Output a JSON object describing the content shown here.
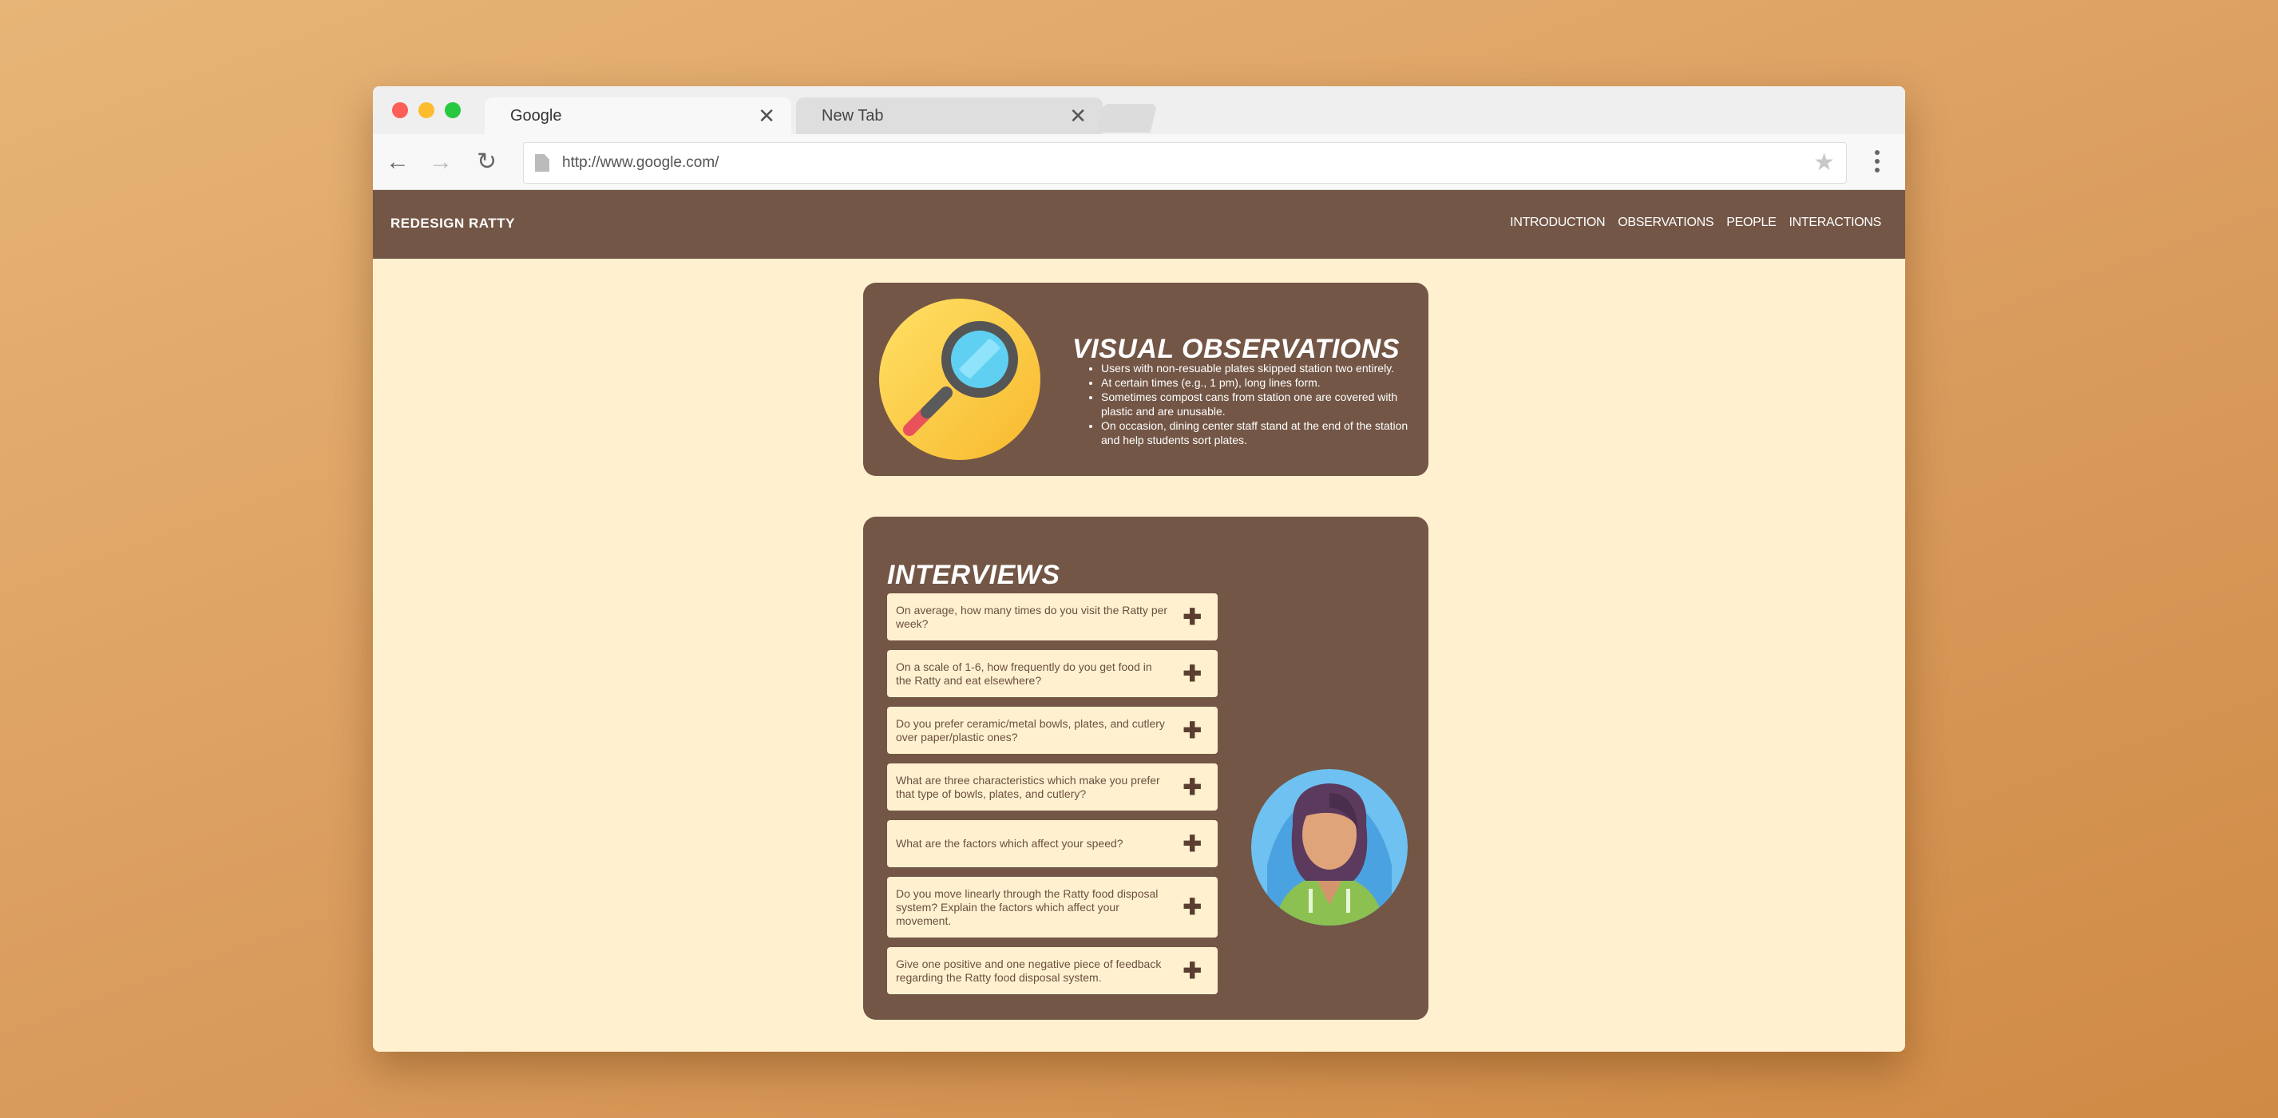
{
  "browser": {
    "tabs": [
      {
        "label": "Google",
        "close": "✕"
      },
      {
        "label": "New Tab",
        "close": "✕"
      }
    ],
    "url": "http://www.google.com/",
    "icons": {
      "back": "←",
      "forward": "→",
      "reload": "↻",
      "star": "★"
    }
  },
  "site": {
    "brand": "REDESIGN RATTY",
    "nav": [
      "INTRODUCTION",
      "OBSERVATIONS",
      "PEOPLE",
      "INTERACTIONS"
    ],
    "colors": {
      "nav_bg": "#735646",
      "page_bg": "#fff1d0",
      "card_bg": "#735646"
    }
  },
  "observations": {
    "title": "VISUAL OBSERVATIONS",
    "items": [
      "Users with non-resuable plates skipped station two entirely.",
      "At certain times (e.g., 1 pm), long lines form.",
      "Sometimes compost cans from station one are covered with plastic and are unusable.",
      "On occasion, dining center staff stand at the end of the station and help students sort plates."
    ]
  },
  "interviews": {
    "title": "INTERVIEWS",
    "expand_icon": "✚",
    "questions": [
      "On average, how many times do you visit the Ratty per week?",
      "On a scale of 1-6, how frequently do you get food in the Ratty and eat elsewhere?",
      "Do you prefer ceramic/metal bowls, plates, and cutlery over paper/plastic ones?",
      "What are three characteristics which make you prefer that type of bowls, plates, and cutlery?",
      "What are the factors which affect your speed?",
      "Do you move linearly through the Ratty food disposal system? Explain the factors which affect your movement.",
      "Give one positive and one negative piece of feedback regarding the Ratty food disposal system."
    ]
  }
}
